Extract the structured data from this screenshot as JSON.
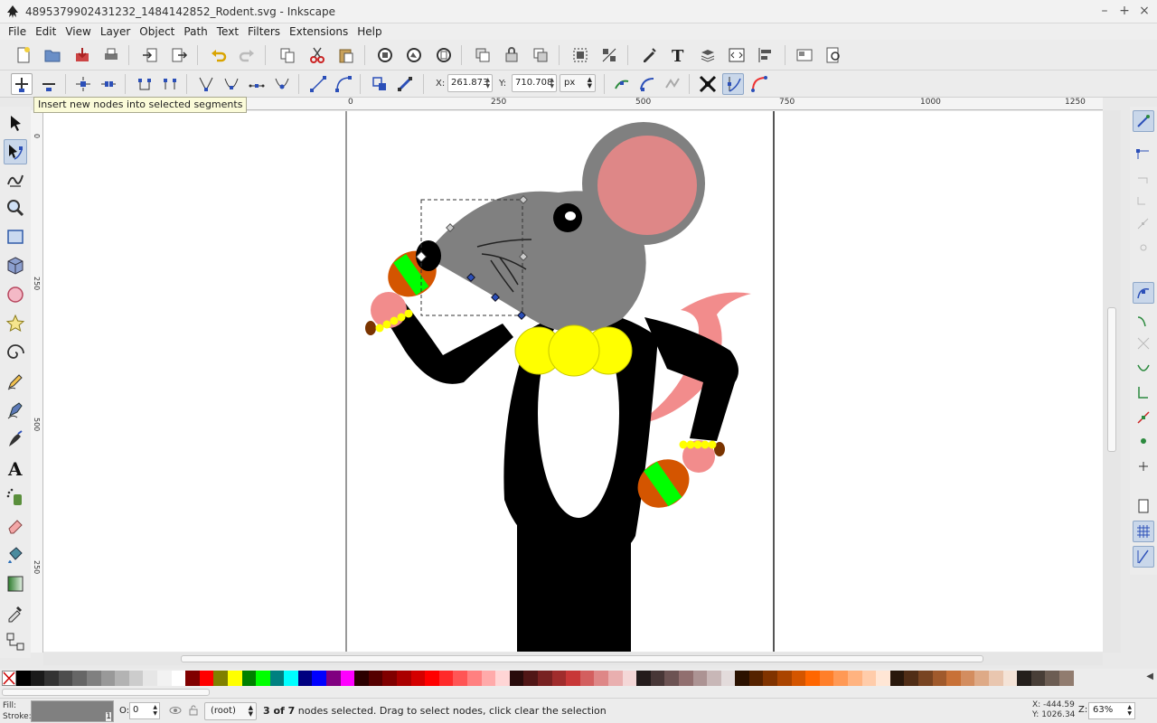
{
  "window": {
    "title": "4895379902431232_1484142852_Rodent.svg - Inkscape",
    "controls": [
      "–",
      "+",
      "×"
    ]
  },
  "menu": [
    "File",
    "Edit",
    "View",
    "Layer",
    "Object",
    "Path",
    "Text",
    "Filters",
    "Extensions",
    "Help"
  ],
  "node_toolbar": {
    "x_label": "X:",
    "x_value": "261.873",
    "y_label": "Y:",
    "y_value": "710.708",
    "unit": "px"
  },
  "tooltip": "Insert new nodes into selected segments",
  "rulers": {
    "horizontal": [
      "0",
      "250",
      "500",
      "750",
      "1000",
      "1250"
    ],
    "vertical": [
      "0",
      "250",
      "500",
      "250"
    ]
  },
  "status": {
    "fill_label": "Fill:",
    "stroke_label": "Stroke:",
    "stroke_width": "1",
    "opacity_label": "O:",
    "opacity_value": "0",
    "layer": "(root)",
    "message_bold": "3 of 7",
    "message_rest": " nodes selected. Drag to select nodes, click clear the selection",
    "cursor_x": "X: -444.59",
    "cursor_y": "Y: 1026.34",
    "zoom_label": "Z:",
    "zoom_value": "63%"
  },
  "palette_colors": [
    "#000000",
    "#1a1a1a",
    "#333333",
    "#4d4d4d",
    "#666666",
    "#808080",
    "#999999",
    "#b3b3b3",
    "#cccccc",
    "#e6e6e6",
    "#f2f2f2",
    "#ffffff",
    "#800000",
    "#ff0000",
    "#808000",
    "#ffff00",
    "#008000",
    "#00ff00",
    "#008080",
    "#00ffff",
    "#000080",
    "#0000ff",
    "#800080",
    "#ff00ff",
    "#2b0000",
    "#550000",
    "#800000",
    "#aa0000",
    "#d40000",
    "#ff0000",
    "#ff2a2a",
    "#ff5555",
    "#ff8080",
    "#ffaaaa",
    "#ffd5d5",
    "#280b0b",
    "#501616",
    "#782121",
    "#a02c2c",
    "#c83737",
    "#d35f5f",
    "#de8787",
    "#e9afaf",
    "#f4d7d7",
    "#241c1c",
    "#483737",
    "#6c5353",
    "#916f6f",
    "#ac9393",
    "#c8b7b7",
    "#e3dbdb",
    "#2b1100",
    "#552200",
    "#803300",
    "#aa4400",
    "#d45500",
    "#ff6600",
    "#ff7f2a",
    "#ff9955",
    "#ffb380",
    "#ffccaa",
    "#ffe6d5",
    "#28170b",
    "#502d16",
    "#784421",
    "#a05a2c",
    "#c87137",
    "#d38d5f",
    "#deaa87",
    "#e9c6af",
    "#f4e3d7",
    "#241f1c",
    "#483e37",
    "#6c5d53",
    "#917c6f"
  ]
}
